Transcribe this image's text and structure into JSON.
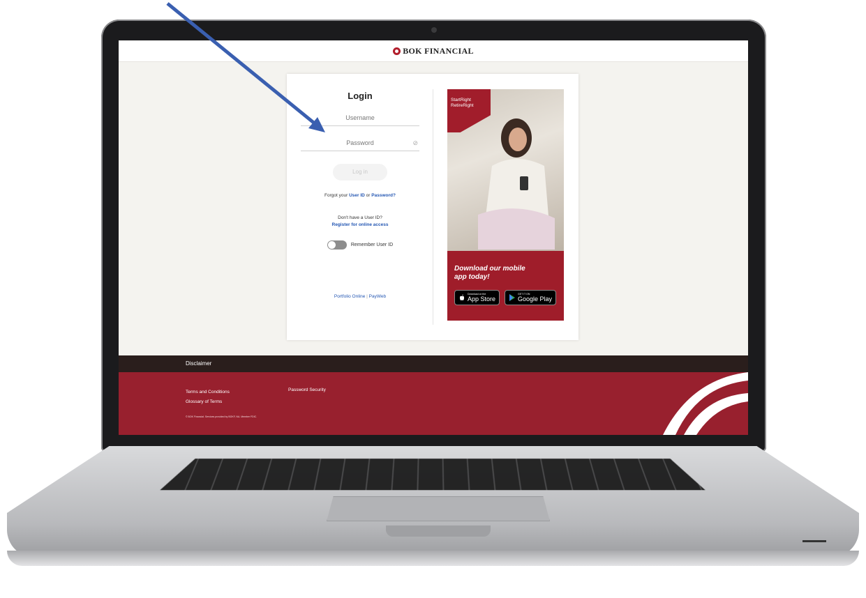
{
  "header": {
    "brand": "BOK FINANCIAL"
  },
  "login": {
    "title": "Login",
    "username_placeholder": "Username",
    "password_placeholder": "Password",
    "login_button": "Log in",
    "forgot_prefix": "Forgot your",
    "forgot_user_id": "User ID",
    "forgot_or": "or",
    "forgot_password": "Password?",
    "no_user_id": "Don't have a User ID?",
    "register": "Register for online access",
    "remember": "Remember User ID",
    "portfolio_online": "Portfolio Online",
    "separator": "|",
    "payweb": "PayWeb"
  },
  "promo": {
    "tag_line1": "StartRight",
    "tag_line2": "RetireRight",
    "headline_line1": "Download our mobile",
    "headline_line2": "app today!",
    "app_store_small": "Download on the",
    "app_store_big": "App Store",
    "google_play_small": "GET IT ON",
    "google_play_big": "Google Play"
  },
  "footer": {
    "disclaimer": "Disclaimer",
    "terms": "Terms and Conditions",
    "glossary": "Glossary of Terms",
    "password_security": "Password Security",
    "copyright": "© BOK Financial. Services provided by BOKF, NA. Member FDIC."
  },
  "colors": {
    "brand_red": "#98202e",
    "link_blue": "#2457b3",
    "arrow_blue": "#3a5fb0",
    "dark_bar": "#2a1e1c"
  }
}
